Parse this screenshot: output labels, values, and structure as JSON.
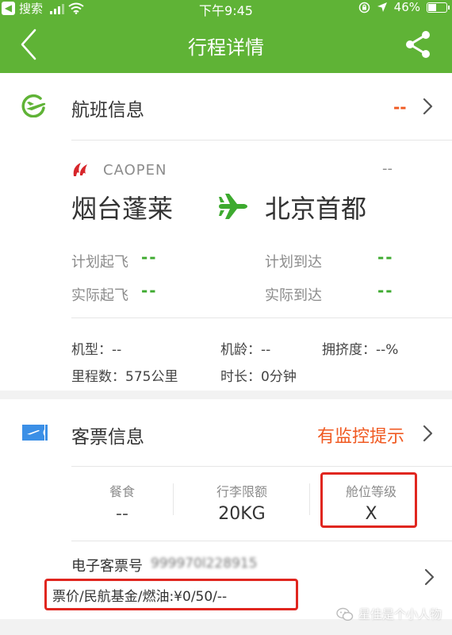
{
  "status_bar": {
    "back_app": "搜索",
    "time": "下午9:45",
    "battery": "46%",
    "battery_level": 0.46
  },
  "nav": {
    "title": "行程详情"
  },
  "flight": {
    "section_title": "航班信息",
    "section_status": "--",
    "airline": "CAOPEN",
    "flight_no": "--",
    "departure_city": "烟台蓬莱",
    "arrival_city": "北京首都",
    "planned_takeoff_label": "计划起飞",
    "planned_takeoff_value": "--",
    "planned_arrival_label": "计划到达",
    "planned_arrival_value": "--",
    "actual_takeoff_label": "实际起飞",
    "actual_takeoff_value": "--",
    "actual_arrival_label": "实际到达",
    "actual_arrival_value": "--",
    "aircraft_type": "机型：--",
    "aircraft_age": "机龄：--",
    "crowdedness": "拥挤度：--%",
    "mileage": "里程数：575公里",
    "duration": "时长：0分钟"
  },
  "ticket": {
    "section_title": "客票信息",
    "monitor_text": "有监控提示",
    "meal_label": "餐食",
    "meal_value": "--",
    "baggage_label": "行李限额",
    "baggage_value": "20KG",
    "cabin_label": "舱位等级",
    "cabin_value": "X",
    "eticket_label": "电子客票号",
    "eticket_value": "999970l228915",
    "price_text": "票价/民航基金/燃油:¥0/50/--"
  },
  "watermark": "星佳是个小人物",
  "colors": {
    "brand_green": "#5fb336",
    "accent_orange": "#f05a22",
    "annotation_red": "#e0261f",
    "ticket_blue": "#3b8fe6"
  }
}
